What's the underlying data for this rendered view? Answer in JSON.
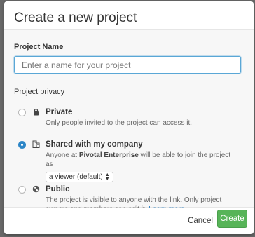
{
  "dialog": {
    "title": "Create a new project"
  },
  "project_name": {
    "label": "Project Name",
    "value": "",
    "placeholder": "Enter a name for your project"
  },
  "privacy": {
    "label": "Project privacy",
    "selected": "shared",
    "options": [
      {
        "id": "private",
        "title": "Private",
        "icon": "lock-icon",
        "description": "Only people invited to the project can access it."
      },
      {
        "id": "shared",
        "title": "Shared with my company",
        "icon": "building-icon",
        "description_prefix": "Anyone at",
        "company": "Pivotal Enterprise",
        "description_suffix": "will be able to join the project as",
        "role_select": "a viewer (default)"
      },
      {
        "id": "public",
        "title": "Public",
        "icon": "globe-icon",
        "description": "The project is visible to anyone with the link. Only project owners and members can edit it.",
        "link": "Learn more"
      }
    ]
  },
  "footer": {
    "cancel_label": "Cancel",
    "create_label": "Create"
  },
  "colors": {
    "accent": "#2d86c7",
    "create_button": "#57b458",
    "input_focus": "#5aa7d6"
  }
}
